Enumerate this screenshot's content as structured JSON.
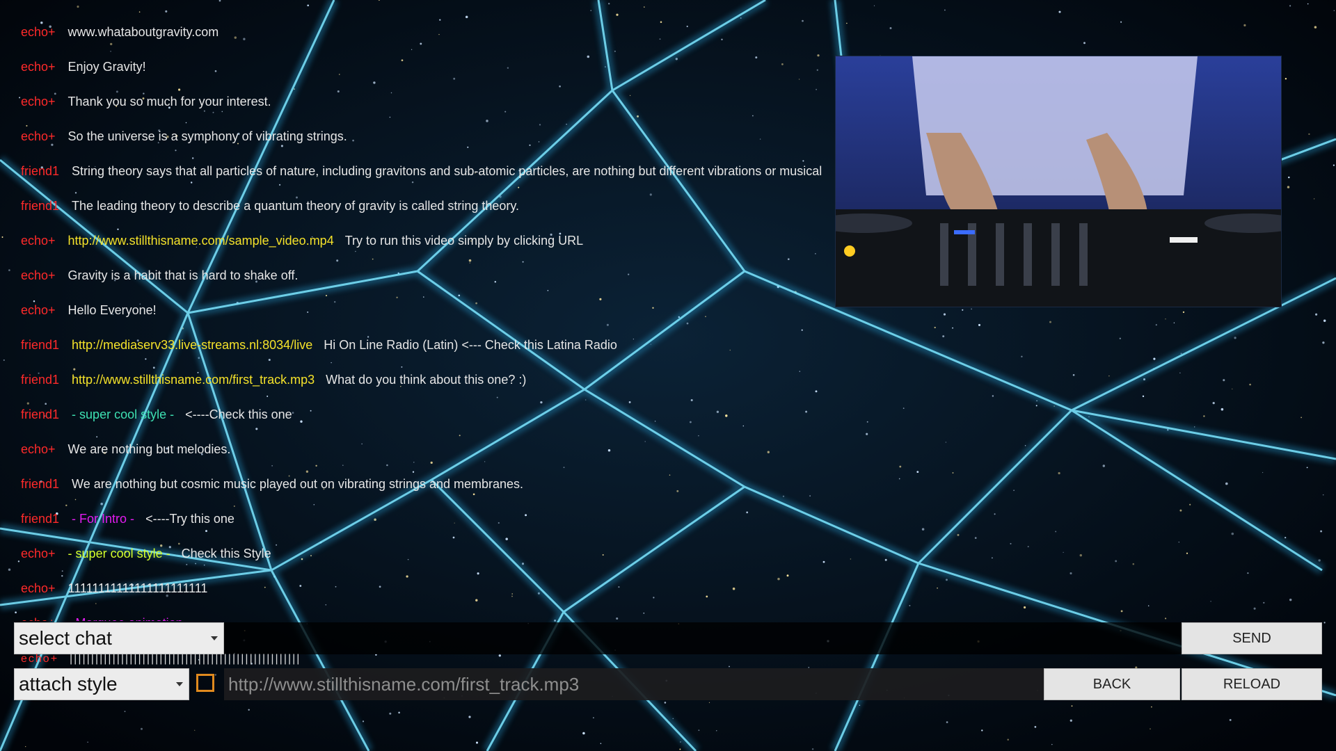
{
  "chat": {
    "messages": [
      {
        "user": "echo+",
        "text": "www.whataboutgravity.com"
      },
      {
        "user": "echo+",
        "text": "Enjoy Gravity!"
      },
      {
        "user": "echo+",
        "text": "Thank you so much for your interest."
      },
      {
        "user": "echo+",
        "text": "So the universe is a symphony of vibrating strings."
      },
      {
        "user": "friend1",
        "text": "String theory says that all particles of nature, including gravitons and sub-atomic particles, are nothing but different vibrations or musical"
      },
      {
        "user": "friend1",
        "text": "The leading theory to describe a quantum theory of gravity is called string theory."
      },
      {
        "user": "echo+",
        "link": "http://www.stillthisname.com/sample_video.mp4",
        "text": "Try to run this video simply by clicking URL"
      },
      {
        "user": "echo+",
        "text": "Gravity is a habit that is hard to shake off."
      },
      {
        "user": "echo+",
        "text": "Hello Everyone!"
      },
      {
        "user": "friend1",
        "link": "http://mediaserv33.live-streams.nl:8034/live",
        "text": "Hi On Line Radio (Latin) <--- Check this Latina Radio"
      },
      {
        "user": "friend1",
        "link": "http://www.stillthisname.com/first_track.mp3",
        "text": "What do you think about this one? :)"
      },
      {
        "user": "friend1",
        "style": "- super cool style -",
        "style_class": "style-a",
        "text": "<----Check this one"
      },
      {
        "user": "echo+",
        "text": "We are nothing but melodies."
      },
      {
        "user": "friend1",
        "text": "We are nothing but cosmic music played out on vibrating strings and membranes."
      },
      {
        "user": "friend1",
        "style": "- For Intro -",
        "style_class": "style-b",
        "text": "<----Try this one"
      },
      {
        "user": "echo+",
        "style": "- super cool style -",
        "style_class": "style-c",
        "text": "Check this Style"
      },
      {
        "user": "echo+",
        "text": "11111111111111111111111"
      },
      {
        "user": "echo+",
        "style": "- Marquee animation -",
        "style_class": "style-b",
        "text": ""
      }
    ],
    "partial_row": {
      "user": "echo+",
      "text": "||||||||||||||||||||||||||||||||||||||||||||||||||||||"
    }
  },
  "controls": {
    "select_chat_label": "select chat",
    "attach_style_label": "attach style",
    "send_label": "SEND",
    "back_label": "BACK",
    "reload_label": "RELOAD",
    "url_value": "http://www.stillthisname.com/first_track.mp3"
  },
  "colors": {
    "user": "#ff2a2a",
    "link": "#f5e22a",
    "grid_line": "#4fd6ff",
    "checkbox": "#e08a1e"
  },
  "icons": {
    "select_caret": "chevron-down-icon",
    "style_checkbox": "checkbox-icon"
  }
}
